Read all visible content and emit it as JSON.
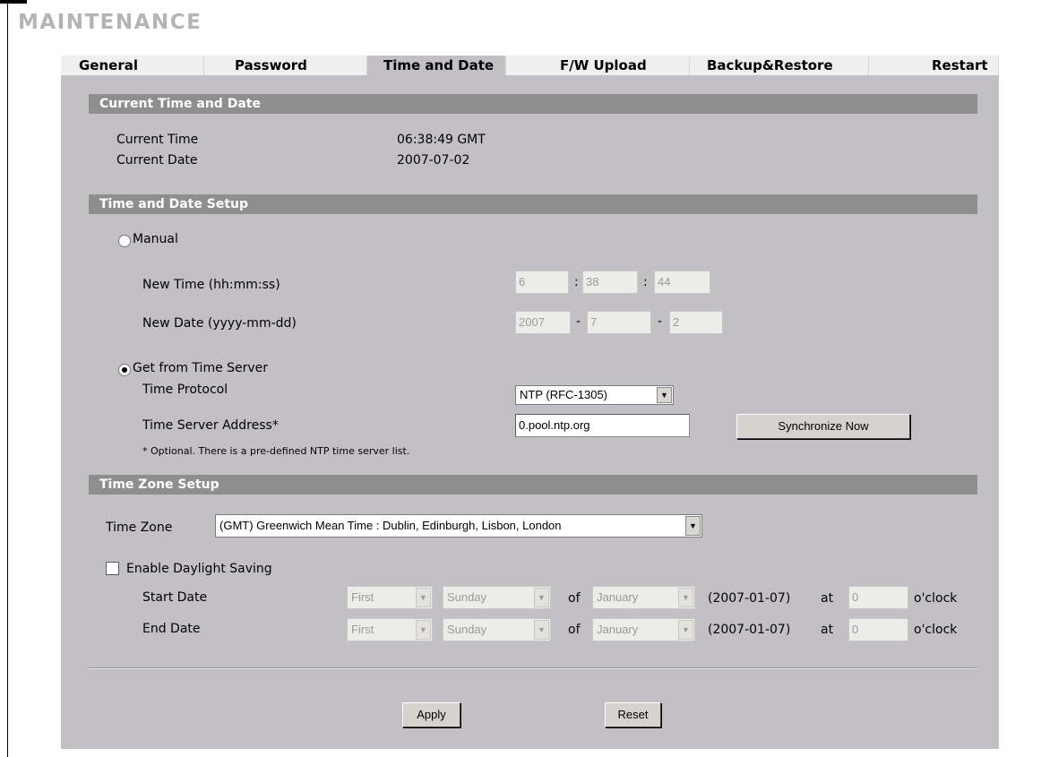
{
  "page_title": "MAINTENANCE",
  "tabs": [
    {
      "label": "General"
    },
    {
      "label": "Password"
    },
    {
      "label": "Time and Date"
    },
    {
      "label": "F/W Upload"
    },
    {
      "label": "Backup&Restore"
    },
    {
      "label": "Restart"
    }
  ],
  "active_tab": "Time and Date",
  "current": {
    "header": "Current Time and Date",
    "time_label": "Current Time",
    "time_value": "06:38:49 GMT",
    "date_label": "Current Date",
    "date_value": "2007-07-02"
  },
  "setup": {
    "header": "Time and Date Setup",
    "manual_label": "Manual",
    "manual_selected": false,
    "new_time_label": "New Time (hh:mm:ss)",
    "hh": "6",
    "mm": "38",
    "ss": "44",
    "time_sep": ":",
    "new_date_label": "New Date (yyyy-mm-dd)",
    "yyyy": "2007",
    "mo": "7",
    "dd": "2",
    "date_sep": "-",
    "server_label": "Get from Time Server",
    "server_selected": true,
    "protocol_label": "Time Protocol",
    "protocol_value": "NTP (RFC-1305)",
    "address_label": "Time Server Address*",
    "address_value": "0.pool.ntp.org",
    "sync_button": "Synchronize Now",
    "note": "* Optional. There is a pre-defined NTP time server list."
  },
  "zone": {
    "header": "Time Zone Setup",
    "tz_label": "Time Zone",
    "tz_value": "(GMT) Greenwich Mean Time : Dublin, Edinburgh, Lisbon, London",
    "dst_label": "Enable Daylight Saving",
    "dst_enabled": false,
    "start_label": "Start Date",
    "end_label": "End Date",
    "week": "First",
    "day": "Sunday",
    "of": "of",
    "month": "January",
    "date_hint": "(2007-01-07)",
    "at": "at",
    "hour": "0",
    "oclock": "o'clock"
  },
  "buttons": {
    "apply": "Apply",
    "reset": "Reset"
  }
}
